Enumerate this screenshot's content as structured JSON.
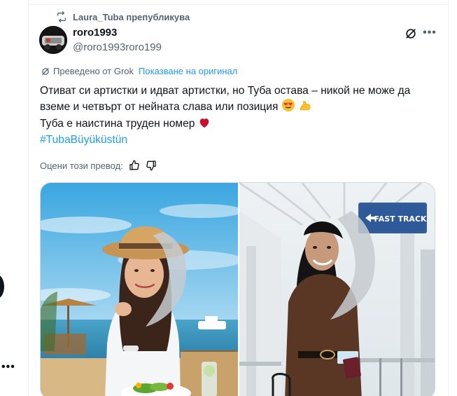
{
  "repost": {
    "user": "Laura_Tuba",
    "action": "препубликува"
  },
  "tweet": {
    "display_name": "roro1993",
    "handle": "@roro1993roro199",
    "translated_prefix": "Преведено от Grok",
    "show_original_label": "Показване на оригинал",
    "lines": [
      "Отиват си артистки и идват артистки, но Туба остава – никой не може да",
      "вземе и четвърт от нейната слава или позиция",
      "Туба е наистина труден номер"
    ],
    "hashtag": "#TubaBüyüküstün",
    "rate_label": "Оцени този превод:"
  },
  "media": {
    "right_sign_text": "FAST TRACK"
  },
  "colors": {
    "accent": "#1d9bf0",
    "secondary_text": "#536471",
    "primary_text": "#0f1419",
    "heart": "#c8102e"
  }
}
